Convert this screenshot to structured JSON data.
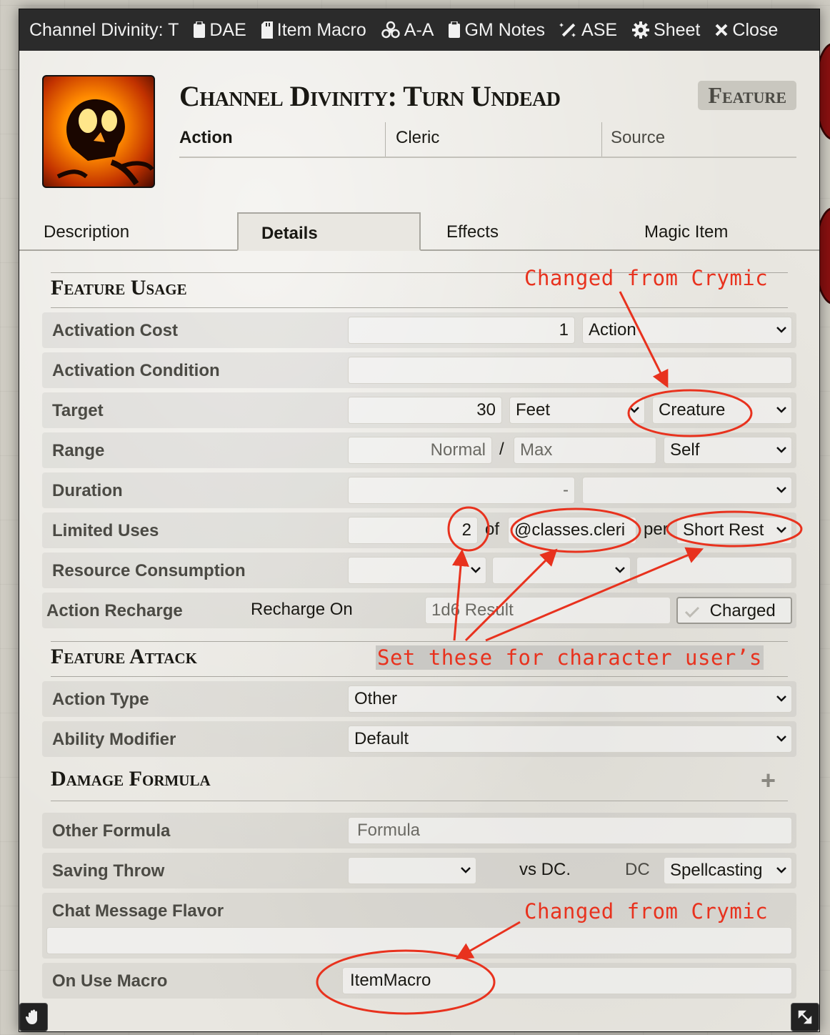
{
  "window": {
    "title": "Channel Divinity: T",
    "header_buttons": [
      {
        "label": "DAE",
        "icon": "clipboard-icon"
      },
      {
        "label": "Item Macro",
        "icon": "sd-card-icon"
      },
      {
        "label": "A-A",
        "icon": "biohazard-icon"
      },
      {
        "label": "GM Notes",
        "icon": "clipboard-icon"
      },
      {
        "label": "ASE",
        "icon": "magic-wand-icon"
      },
      {
        "label": "Sheet",
        "icon": "gear-icon"
      },
      {
        "label": "Close",
        "icon": "close-icon"
      }
    ]
  },
  "item": {
    "name": "Channel Divinity: Turn Undead",
    "type_badge": "Feature",
    "activation": "Action",
    "requirement": "Cleric",
    "source_placeholder": "Source"
  },
  "tabs": [
    "Description",
    "Details",
    "Effects",
    "Magic Item"
  ],
  "active_tab": "Details",
  "feature_usage": {
    "heading": "Feature Usage",
    "activation_cost": {
      "label": "Activation Cost",
      "value": "1",
      "type": "Action"
    },
    "activation_condition": {
      "label": "Activation Condition",
      "value": ""
    },
    "target": {
      "label": "Target",
      "value": "30",
      "units": "Feet",
      "type": "Creature"
    },
    "range": {
      "label": "Range",
      "normal_placeholder": "Normal",
      "separator": "/",
      "max_placeholder": "Max",
      "units": "Self"
    },
    "duration": {
      "label": "Duration",
      "value": "-",
      "units": ""
    },
    "limited_uses": {
      "label": "Limited Uses",
      "value": "2",
      "of": "of",
      "max": "@classes.cleri",
      "per": "per",
      "period": "Short Rest"
    },
    "resource_consumption": {
      "label": "Resource Consumption"
    },
    "action_recharge": {
      "label": "Action Recharge",
      "recharge_on": "Recharge On",
      "placeholder": "1d6 Result",
      "charged": "Charged"
    }
  },
  "feature_attack": {
    "heading": "Feature Attack",
    "action_type": {
      "label": "Action Type",
      "value": "Other"
    },
    "ability_modifier": {
      "label": "Ability Modifier",
      "value": "Default"
    }
  },
  "damage_formula": {
    "heading": "Damage Formula",
    "add": "+",
    "other_formula": {
      "label": "Other Formula",
      "placeholder": "Formula"
    },
    "saving_throw": {
      "label": "Saving Throw",
      "vs": "vs DC.",
      "dc": "DC",
      "scaling": "Spellcasting"
    },
    "chat_flavor": {
      "label": "Chat Message Flavor",
      "value": ""
    },
    "on_use_macro": {
      "label": "On Use Macro",
      "value": "ItemMacro"
    }
  },
  "annotations": {
    "changed_top": "Changed from Crymic",
    "set_these": "Set these for character user’s",
    "changed_bottom": "Changed from Crymic",
    "color": "#e8321e"
  }
}
